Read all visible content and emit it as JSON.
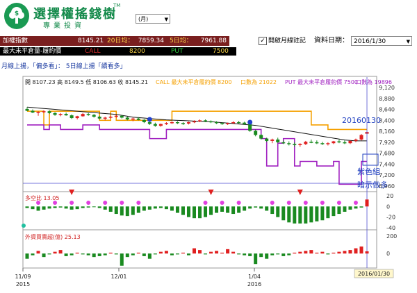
{
  "brand": {
    "title": "選擇權搖錢樹",
    "subtitle": "專業投資",
    "tm": "TM"
  },
  "period_select": {
    "value": "(月)"
  },
  "quote_bar": {
    "index_label": "加權指數",
    "index_value": "8145.21",
    "ma20_label": "20日均：",
    "ma20_value": "7859.34",
    "ma5_label": "5日均：",
    "ma5_value": "7961.88"
  },
  "annotation_checkbox": {
    "checked": true,
    "label": "開啟月線註記"
  },
  "date_field": {
    "label": "資料日期：",
    "value": "2016/1/30"
  },
  "oi_bar": {
    "label": "最大未平倉量-履約價",
    "call_label": "CALL",
    "call_value": "8200",
    "put_label": "PUT",
    "put_value": "7500"
  },
  "trend_text": "月線上揚，「偏多看」：  5日線上揚「續看多」",
  "chart_header": {
    "ohlc": "開 8107.23  高 8149.5  低 8106.63  收 8145.21",
    "call_text": "CALL 最大未平倉履約價 8200",
    "call_oi_text": "口數為 21022",
    "put_text": "PUT 最大未平倉履約價 7500",
    "put_oi_text": "口數為 19896"
  },
  "annotations": {
    "date": "20160130",
    "purple_note_1": "紫色組",
    "purple_note_2": "暗示做多"
  },
  "panels": {
    "long_short_label": "多空比 13.05",
    "foreign_label": "外資買賣超(億) 25.13"
  },
  "cursor_date": "2016/01/30",
  "colors": {
    "call_line": "#f5a000",
    "put_line": "#a020c0",
    "ma_line": "#111111",
    "up": "#e02020",
    "down": "#1a8a20",
    "accent": "#1a9a53"
  },
  "chart_data": [
    {
      "type": "line",
      "title": "",
      "y_ticks": [
        "9,120",
        "8,880",
        "8,640",
        "8,400",
        "8,160",
        "7,920",
        "7,680",
        "7,440",
        "7,200",
        "6,960"
      ],
      "ylim": [
        6960,
        9120
      ],
      "x_ticks": [
        {
          "label": "11/09",
          "sub": "2015"
        },
        {
          "label": "12/01",
          "sub": ""
        },
        {
          "label": "1/04",
          "sub": "2016"
        }
      ],
      "series": [
        {
          "name": "CALL 最大未平倉履約價",
          "values": [
            8600,
            8600,
            8600,
            8300,
            8600,
            8600,
            8600,
            8600,
            8600,
            8600,
            8600,
            8600,
            8600,
            8400,
            8400,
            8600,
            8400,
            8400,
            8400,
            8400,
            8400,
            8400,
            8400,
            8400,
            8400,
            8400,
            8600,
            8600,
            8600,
            8600,
            8600,
            8600,
            8600,
            8600,
            8600,
            8600,
            8600,
            8600,
            8600,
            8600,
            8600,
            8600,
            8600,
            8600,
            8600,
            8600,
            8600,
            8600,
            8600,
            8600,
            8600,
            8300,
            8300,
            8300,
            8200,
            8200,
            8200,
            8200,
            8200,
            8200,
            8200,
            8200
          ]
        },
        {
          "name": "PUT 最大未平倉履約價",
          "values": [
            8300,
            8300,
            8300,
            8200,
            8300,
            8300,
            8200,
            8200,
            8200,
            8200,
            8300,
            8300,
            8300,
            8200,
            8200,
            8200,
            8200,
            8200,
            8200,
            8200,
            8200,
            8200,
            8000,
            8000,
            8000,
            8200,
            8200,
            8200,
            8200,
            8200,
            8200,
            8200,
            8200,
            8200,
            8200,
            8200,
            8200,
            8200,
            8200,
            8200,
            8200,
            8200,
            8000,
            7400,
            7400,
            7900,
            8000,
            8000,
            7400,
            7500,
            7500,
            7500,
            7400,
            7400,
            7400,
            7500,
            7000,
            7000,
            7000,
            7000,
            7500,
            7500
          ]
        },
        {
          "name": "MA",
          "values": [
            8690,
            8680,
            8670,
            8660,
            8650,
            8640,
            8630,
            8620,
            8610,
            8600,
            8590,
            8580,
            8570,
            8560,
            8550,
            8540,
            8530,
            8510,
            8490,
            8470,
            8460,
            8450,
            8440,
            8430,
            8420,
            8410,
            8405,
            8400,
            8395,
            8390,
            8385,
            8380,
            8375,
            8370,
            8360,
            8350,
            8340,
            8330,
            8320,
            8310,
            8300,
            8290,
            8270,
            8250,
            8230,
            8210,
            8190,
            8170,
            8150,
            8130,
            8110,
            8090,
            8070,
            8050,
            8030,
            8010,
            7990,
            7970,
            7960,
            7950,
            7950,
            7950
          ]
        }
      ],
      "candles": [
        [
          8650,
          8690,
          8600,
          8610
        ],
        [
          8610,
          8640,
          8560,
          8570
        ],
        [
          8570,
          8600,
          8500,
          8580
        ],
        [
          8580,
          8620,
          8560,
          8600
        ],
        [
          8600,
          8620,
          8540,
          8560
        ],
        [
          8560,
          8580,
          8500,
          8520
        ],
        [
          8520,
          8560,
          8490,
          8540
        ],
        [
          8540,
          8570,
          8500,
          8510
        ],
        [
          8510,
          8530,
          8430,
          8450
        ],
        [
          8450,
          8500,
          8420,
          8490
        ],
        [
          8490,
          8560,
          8480,
          8540
        ],
        [
          8540,
          8560,
          8500,
          8520
        ],
        [
          8520,
          8540,
          8460,
          8480
        ],
        [
          8480,
          8500,
          8420,
          8440
        ],
        [
          8440,
          8480,
          8400,
          8460
        ],
        [
          8460,
          8500,
          8440,
          8480
        ],
        [
          8480,
          8520,
          8460,
          8500
        ],
        [
          8500,
          8520,
          8440,
          8460
        ],
        [
          8460,
          8480,
          8400,
          8420
        ],
        [
          8420,
          8460,
          8380,
          8440
        ],
        [
          8440,
          8470,
          8400,
          8410
        ],
        [
          8410,
          8430,
          8340,
          8360
        ],
        [
          8360,
          8380,
          8300,
          8320
        ],
        [
          8320,
          8350,
          8260,
          8280
        ],
        [
          8280,
          8330,
          8260,
          8320
        ],
        [
          8320,
          8360,
          8300,
          8340
        ],
        [
          8340,
          8380,
          8320,
          8360
        ],
        [
          8360,
          8380,
          8320,
          8340
        ],
        [
          8340,
          8360,
          8300,
          8330
        ],
        [
          8330,
          8370,
          8310,
          8360
        ],
        [
          8360,
          8400,
          8340,
          8380
        ],
        [
          8380,
          8420,
          8360,
          8400
        ],
        [
          8400,
          8420,
          8360,
          8380
        ],
        [
          8380,
          8400,
          8340,
          8360
        ],
        [
          8360,
          8380,
          8320,
          8340
        ],
        [
          8340,
          8360,
          8300,
          8320
        ],
        [
          8320,
          8350,
          8300,
          8340
        ],
        [
          8340,
          8380,
          8320,
          8360
        ],
        [
          8360,
          8390,
          8330,
          8350
        ],
        [
          8350,
          8370,
          8300,
          8320
        ],
        [
          8320,
          8340,
          8150,
          8170
        ],
        [
          8170,
          8200,
          8050,
          8080
        ],
        [
          8080,
          8100,
          7980,
          8000
        ],
        [
          8000,
          8020,
          7920,
          7950
        ],
        [
          7950,
          8000,
          7900,
          7980
        ],
        [
          7980,
          8020,
          7900,
          7920
        ],
        [
          7920,
          7960,
          7880,
          7900
        ],
        [
          7900,
          7940,
          7850,
          7880
        ],
        [
          7880,
          7920,
          7820,
          7860
        ],
        [
          7860,
          7900,
          7820,
          7880
        ],
        [
          7880,
          7950,
          7860,
          7930
        ],
        [
          7930,
          7980,
          7900,
          7920
        ],
        [
          7920,
          7960,
          7880,
          7900
        ],
        [
          7900,
          7930,
          7860,
          7880
        ],
        [
          7880,
          7920,
          7850,
          7900
        ],
        [
          7900,
          7950,
          7880,
          7940
        ],
        [
          7940,
          7980,
          7900,
          7920
        ],
        [
          7920,
          7960,
          7880,
          7900
        ],
        [
          7900,
          7960,
          7880,
          7950
        ],
        [
          7950,
          8000,
          7920,
          7980
        ],
        [
          7980,
          8100,
          7960,
          8080
        ],
        [
          8107,
          8150,
          8106,
          8145
        ]
      ]
    },
    {
      "type": "bar",
      "title": "多空比 13.05",
      "y_ticks": [
        "20",
        "0",
        "-20",
        "-40"
      ],
      "ylim": [
        -40,
        20
      ],
      "values": [
        -3,
        -5,
        -8,
        -6,
        -4,
        -3,
        -2,
        -4,
        -6,
        -5,
        -3,
        -2,
        -1,
        -3,
        -6,
        -10,
        -14,
        -17,
        -18,
        -16,
        -12,
        -8,
        -6,
        -4,
        -3,
        -5,
        -8,
        -12,
        -16,
        -20,
        -22,
        -22,
        -20,
        -16,
        -12,
        -10,
        -12,
        -14,
        -12,
        -8,
        -4,
        -2,
        -4,
        -8,
        -14,
        -20,
        -26,
        -30,
        -32,
        -32,
        -32,
        -30,
        -28,
        -26,
        -22,
        -18,
        -14,
        -10,
        -6,
        -4,
        -2,
        13.05
      ]
    },
    {
      "type": "bar",
      "title": "外資買賣超(億)",
      "y_ticks": [
        "200",
        "0"
      ],
      "ylim": [
        -150,
        200
      ],
      "values": [
        -60,
        -20,
        30,
        -40,
        -10,
        20,
        40,
        -30,
        -20,
        10,
        -10,
        -20,
        -40,
        -30,
        -20,
        10,
        -10,
        -140,
        -40,
        -20,
        10,
        -30,
        -60,
        -10,
        20,
        30,
        -20,
        -10,
        10,
        -20,
        60,
        40,
        -10,
        20,
        30,
        10,
        50,
        20,
        -10,
        -20,
        -30,
        -120,
        -40,
        -60,
        -20,
        -10,
        -30,
        -20,
        10,
        20,
        30,
        40,
        10,
        20,
        -10,
        10,
        20,
        30,
        40,
        60,
        80,
        25.13
      ]
    }
  ]
}
